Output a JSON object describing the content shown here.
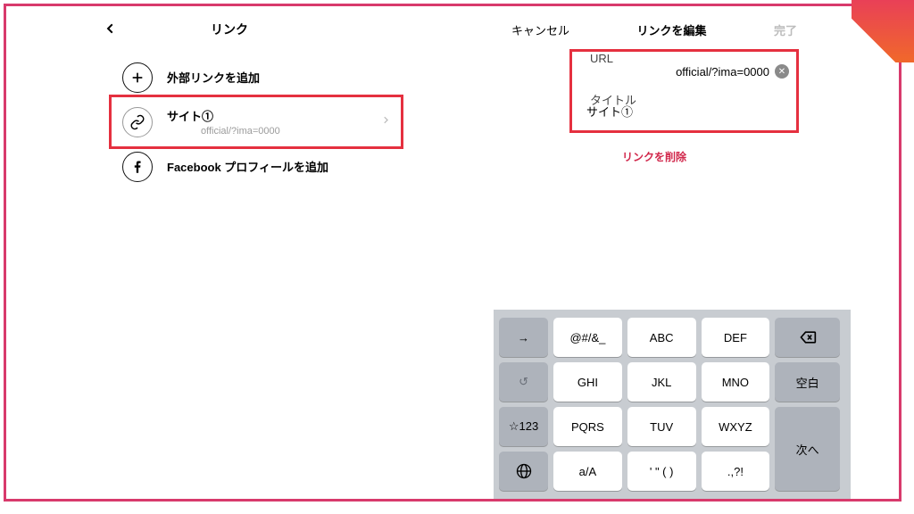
{
  "left": {
    "title": "リンク",
    "add_external": "外部リンクを追加",
    "site_label": "サイト①",
    "site_url": "official/?ima=0000",
    "add_facebook": "Facebook プロフィールを追加"
  },
  "right": {
    "cancel": "キャンセル",
    "title": "リンクを編集",
    "done": "完了",
    "url_label": "URL",
    "url_value": "official/?ima=0000",
    "title_label": "タイトル",
    "title_value": "サイト①",
    "delete": "リンクを削除"
  },
  "keyboard": {
    "arrow": "→",
    "k1": "@#/&_",
    "k2": "ABC",
    "k3": "DEF",
    "del": "⌫",
    "undo": "↺",
    "k4": "GHI",
    "k5": "JKL",
    "k6": "MNO",
    "space": "空白",
    "sym": "☆123",
    "k7": "PQRS",
    "k8": "TUV",
    "k9": "WXYZ",
    "next": "次へ",
    "globe": "🌐",
    "k10": "a/A",
    "k11": "' \" ( )",
    "k12": ".,?!"
  }
}
